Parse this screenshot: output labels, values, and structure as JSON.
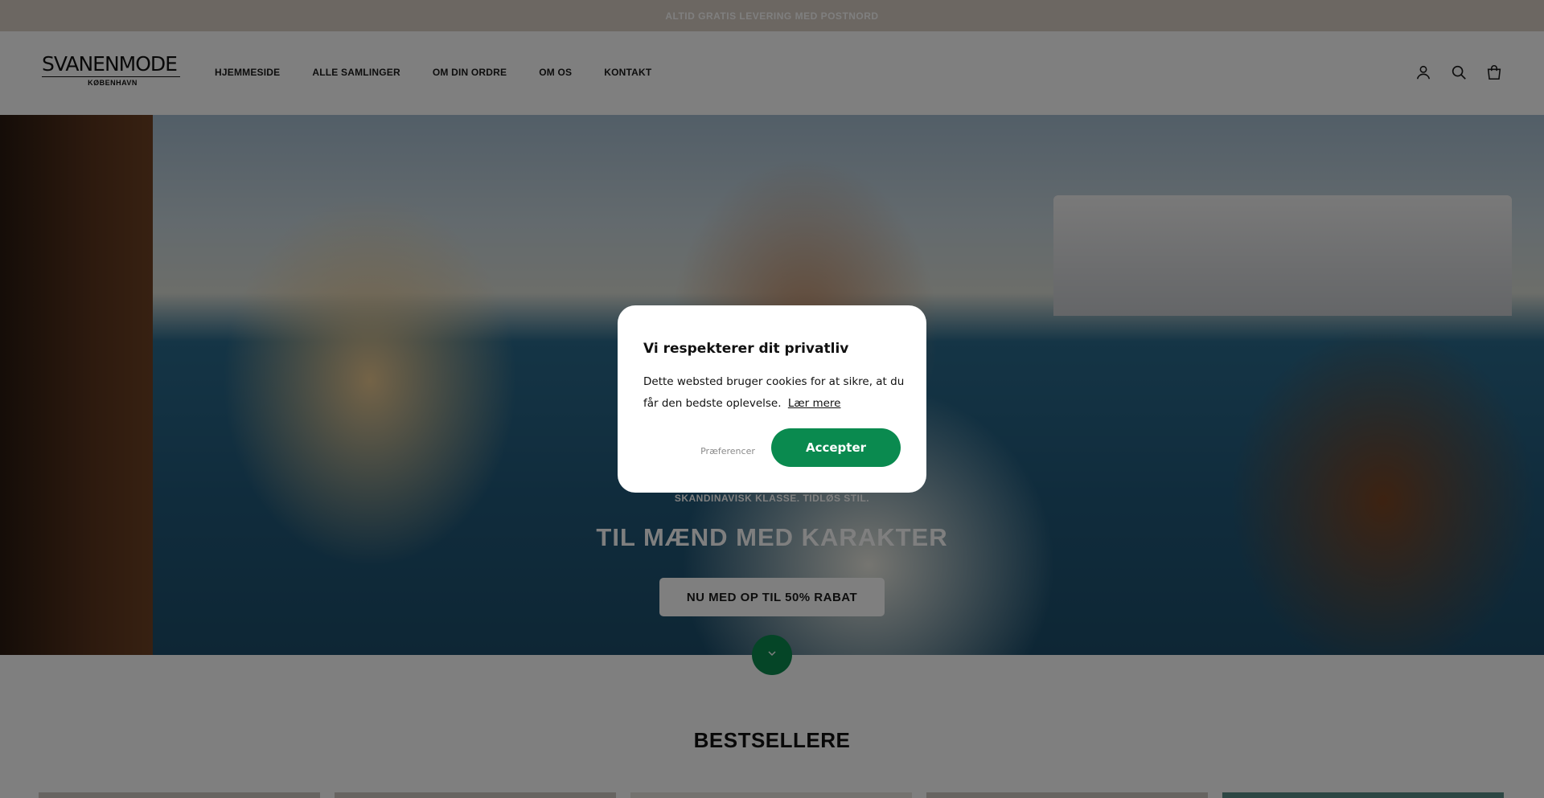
{
  "announcement": {
    "text": "ALTID GRATIS LEVERING MED POSTNORD"
  },
  "header": {
    "logo_brand": "SVANENMODE",
    "logo_city": "KØBENHAVN",
    "nav": [
      "HJEMMESIDE",
      "ALLE SAMLINGER",
      "OM DIN ORDRE",
      "OM OS",
      "KONTAKT"
    ],
    "icons": [
      "account-icon",
      "search-icon",
      "cart-icon"
    ]
  },
  "hero": {
    "subtitle": "SKANDINAVISK KLASSE. TIDLØS STIL.",
    "title": "TIL MÆND MED KARAKTER",
    "button": "NU MED OP TIL 50% RABAT"
  },
  "section": {
    "title": "BESTSELLERE"
  },
  "cookie_modal": {
    "title": "Vi respekterer dit privatliv",
    "body": "Dette websted bruger cookies for at sikre, at du får den bedste oplevelse.",
    "learn_more": "Lær mere",
    "preferences": "Præferencer",
    "accept": "Accepter"
  },
  "colors": {
    "announcement_bg": "#d9cfc4",
    "accent_green": "#0a8a4f",
    "overlay": "rgba(0,0,0,0.5)"
  }
}
